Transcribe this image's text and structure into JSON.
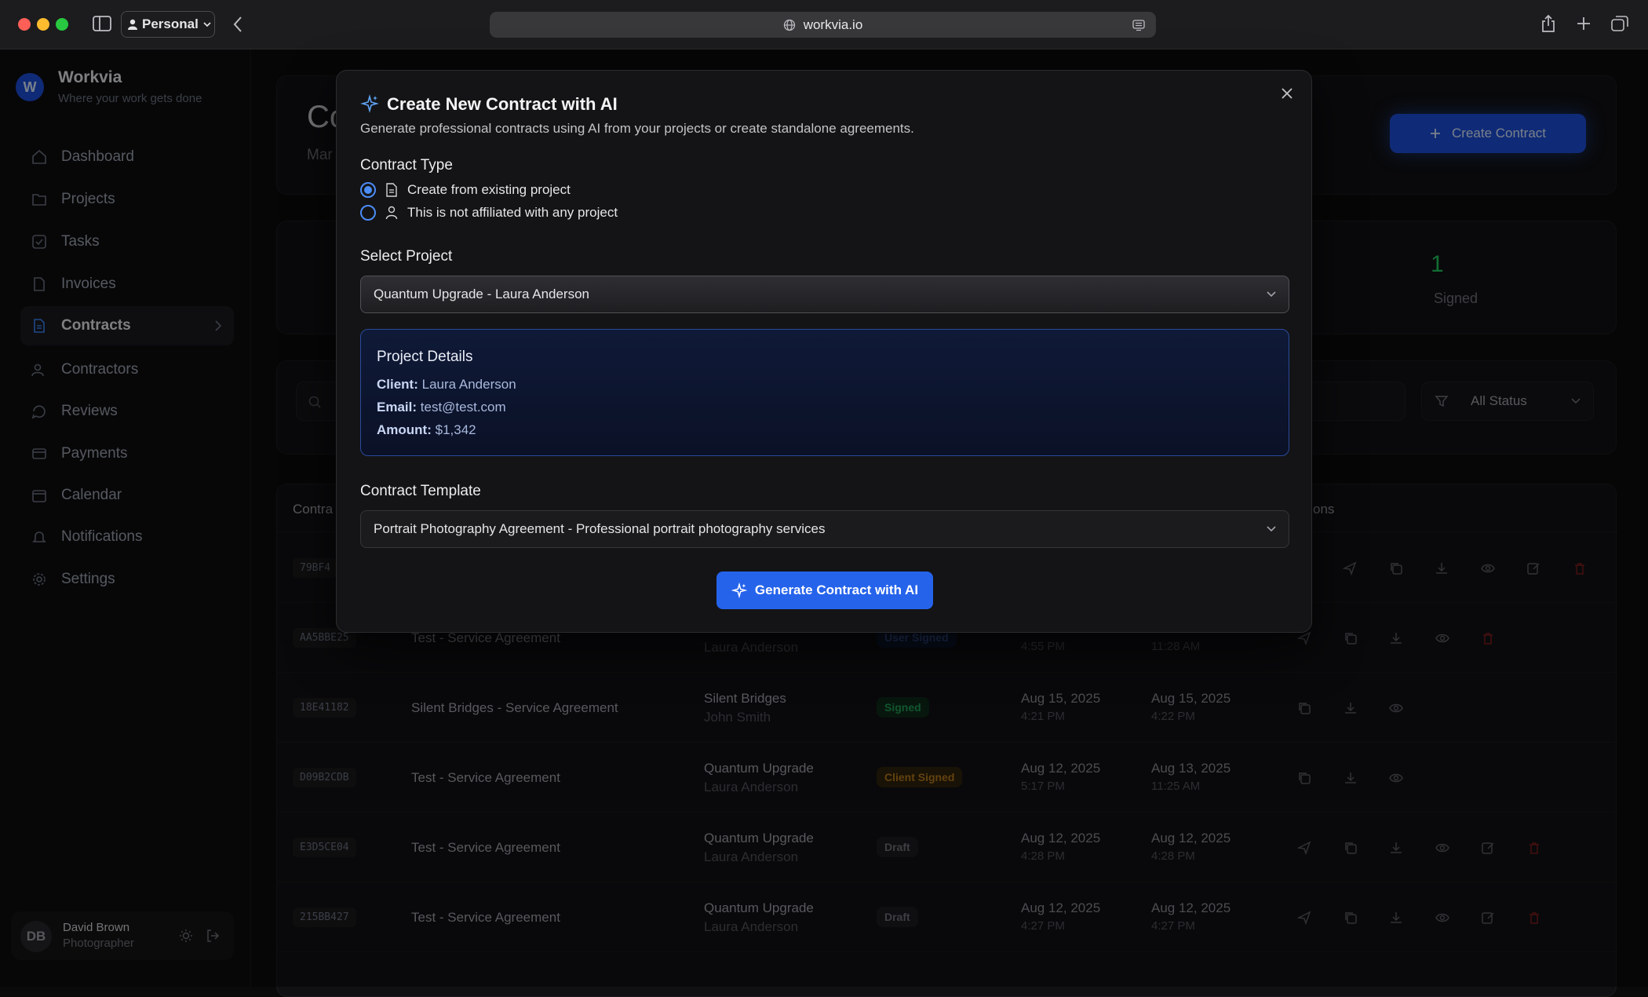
{
  "browser": {
    "profile_label": "Personal",
    "url": "workvia.io"
  },
  "sidebar": {
    "brand_initial": "W",
    "brand_name": "Workvia",
    "tagline": "Where your work gets done",
    "items": [
      {
        "label": "Dashboard",
        "icon": "home-icon"
      },
      {
        "label": "Projects",
        "icon": "folder-icon"
      },
      {
        "label": "Tasks",
        "icon": "checkbox-icon"
      },
      {
        "label": "Invoices",
        "icon": "file-icon"
      },
      {
        "label": "Contracts",
        "icon": "file-text-icon"
      },
      {
        "label": "Contractors",
        "icon": "users-icon"
      },
      {
        "label": "Reviews",
        "icon": "message-icon"
      },
      {
        "label": "Payments",
        "icon": "credit-card-icon"
      },
      {
        "label": "Calendar",
        "icon": "calendar-icon"
      },
      {
        "label": "Notifications",
        "icon": "bell-icon"
      },
      {
        "label": "Settings",
        "icon": "gear-icon"
      }
    ],
    "user": {
      "initials": "DB",
      "name": "David Brown",
      "role": "Photographer"
    }
  },
  "main": {
    "title_partial": "Co",
    "subtitle_partial": "Mar",
    "create_button": "Create Contract",
    "signed_count": "1",
    "signed_label": "Signed",
    "status_filter": "All Status",
    "col_contract_partial": "Contra",
    "col_actions_partial": "ons",
    "rows": [
      {
        "id": "79BF4",
        "title": "",
        "project": "",
        "client": "",
        "status": "",
        "created": "",
        "created_time": "",
        "updated": "",
        "updated_time": ""
      },
      {
        "id": "AA5BBE25",
        "title": "Test - Service Agreement",
        "project": "",
        "client": "Laura Anderson",
        "status": "User Signed",
        "created": "",
        "created_time": "4:55 PM",
        "updated": "",
        "updated_time": "11:28 AM"
      },
      {
        "id": "18E41182",
        "title": "Silent Bridges - Service Agreement",
        "project": "Silent Bridges",
        "client": "John Smith",
        "status": "Signed",
        "created": "Aug 15, 2025",
        "created_time": "4:21 PM",
        "updated": "Aug 15, 2025",
        "updated_time": "4:22 PM"
      },
      {
        "id": "D09B2CDB",
        "title": "Test - Service Agreement",
        "project": "Quantum Upgrade",
        "client": "Laura Anderson",
        "status": "Client Signed",
        "created": "Aug 12, 2025",
        "created_time": "5:17 PM",
        "updated": "Aug 13, 2025",
        "updated_time": "11:25 AM"
      },
      {
        "id": "E3D5CE04",
        "title": "Test - Service Agreement",
        "project": "Quantum Upgrade",
        "client": "Laura Anderson",
        "status": "Draft",
        "created": "Aug 12, 2025",
        "created_time": "4:28 PM",
        "updated": "Aug 12, 2025",
        "updated_time": "4:28 PM"
      },
      {
        "id": "215BB427",
        "title": "Test - Service Agreement",
        "project": "Quantum Upgrade",
        "client": "Laura Anderson",
        "status": "Draft",
        "created": "Aug 12, 2025",
        "created_time": "4:27 PM",
        "updated": "Aug 12, 2025",
        "updated_time": "4:27 PM"
      }
    ]
  },
  "modal": {
    "title": "Create New Contract with AI",
    "subtitle": "Generate professional contracts using AI from your projects or create standalone agreements.",
    "contract_type_label": "Contract Type",
    "option_existing": "Create from existing project",
    "option_unaffiliated": "This is not affiliated with any project",
    "select_project_label": "Select Project",
    "selected_project": "Quantum Upgrade - Laura Anderson",
    "details": {
      "title": "Project Details",
      "client_label": "Client:",
      "client": "Laura Anderson",
      "email_label": "Email:",
      "email": "test@test.com",
      "amount_label": "Amount:",
      "amount": "$1,342"
    },
    "template_label": "Contract Template",
    "selected_template": "Portrait Photography Agreement - Professional portrait photography services",
    "generate_button": "Generate Contract with AI"
  },
  "colors": {
    "accent": "#2563eb",
    "signed": "#22c55e",
    "client_signed": "#f59e0b",
    "delete": "#dc2626"
  }
}
